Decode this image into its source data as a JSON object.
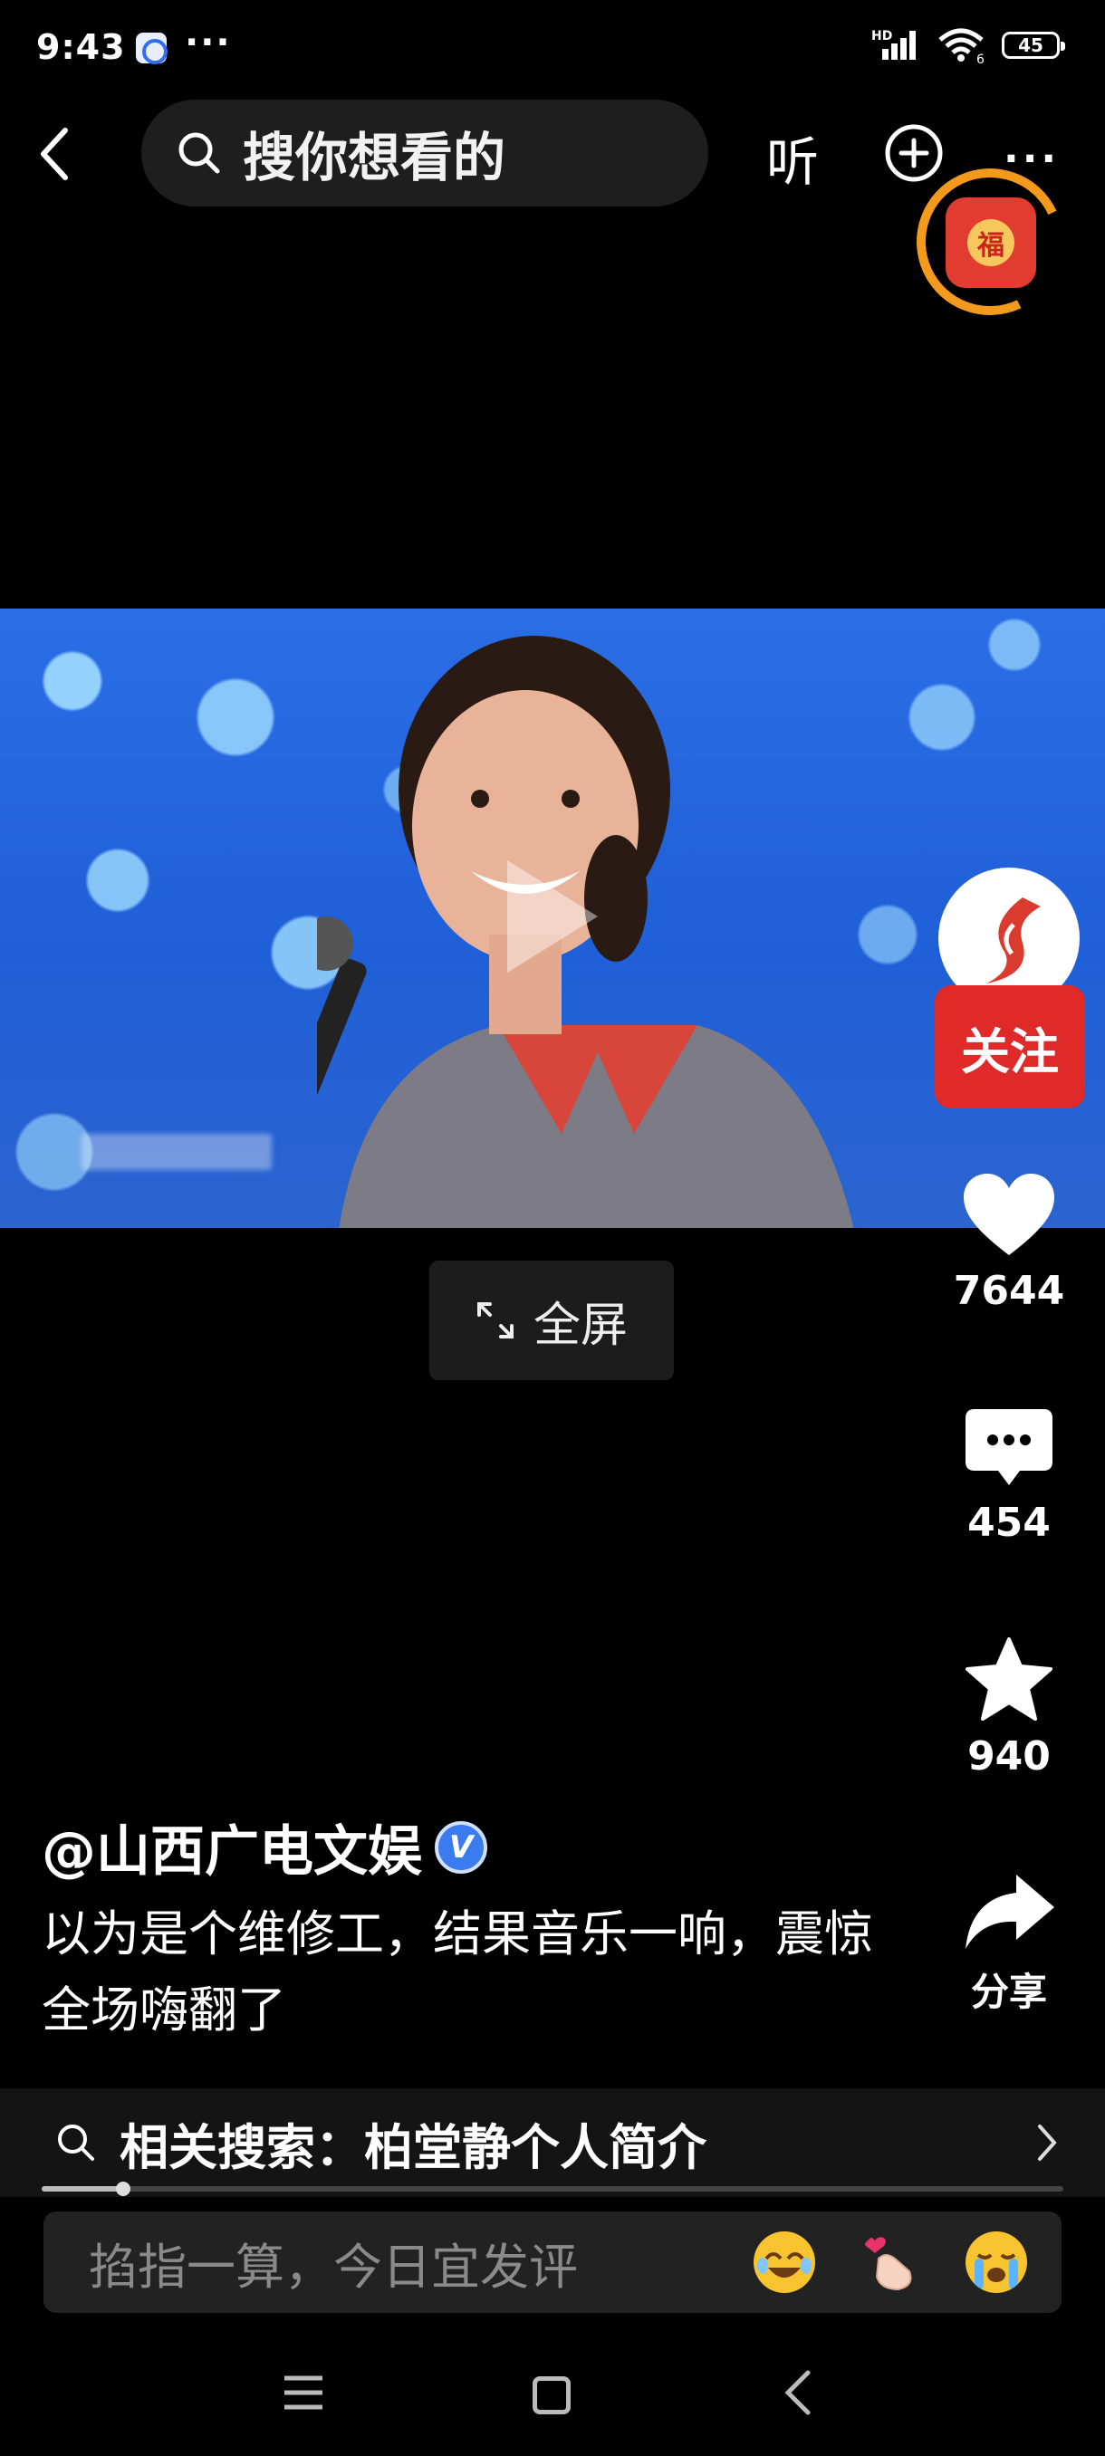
{
  "status_bar": {
    "time": "9:43",
    "more": "···",
    "hd": "HD",
    "wifi_label": "6",
    "battery": "45"
  },
  "nav": {
    "search_placeholder": "搜你想看的",
    "listen_label": "听",
    "more_label": "···",
    "fu_badge_label": "福"
  },
  "video": {
    "fullscreen_label": "全屏"
  },
  "actions": {
    "follow_label": "关注",
    "likes": "7644",
    "comments": "454",
    "favorites": "940",
    "share_label": "分享"
  },
  "post": {
    "author": "@山西广电文娱",
    "verified_mark": "V",
    "description": "以为是个维修工，结果音乐一响，震惊全场嗨翻了"
  },
  "related_search": {
    "label": "相关搜索：柏堂静个人简介"
  },
  "progress": {
    "fraction": 0.08
  },
  "comment": {
    "placeholder": "掐指一算，今日宜发评"
  },
  "colors": {
    "follow": "#e02a2a",
    "badge_ring": "#f39a1c",
    "verified": "#3b7bf0"
  }
}
